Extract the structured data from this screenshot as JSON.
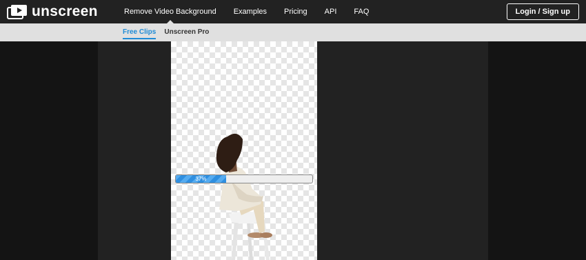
{
  "header": {
    "logo_text": "unscreen",
    "nav": [
      {
        "label": "Remove Video Background",
        "active": true
      },
      {
        "label": "Examples",
        "active": false
      },
      {
        "label": "Pricing",
        "active": false
      },
      {
        "label": "API",
        "active": false
      },
      {
        "label": "FAQ",
        "active": false
      }
    ],
    "login_label": "Login / Sign up"
  },
  "subnav": {
    "items": [
      {
        "label": "Free Clips",
        "active": true
      },
      {
        "label": "Unscreen Pro",
        "active": false
      }
    ]
  },
  "progress": {
    "value": 0.37,
    "label": "37%"
  },
  "colors": {
    "header_bg": "#222222",
    "subbar_bg": "#e0e0e0",
    "accent": "#1e8bd6",
    "page_bg": "#141414"
  }
}
